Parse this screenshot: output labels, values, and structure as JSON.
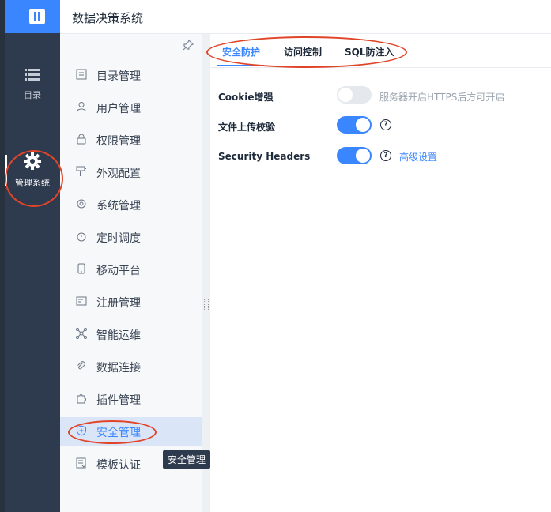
{
  "app": {
    "title": "数据决策系统"
  },
  "rail": {
    "items": [
      {
        "label": "目录",
        "icon": "list-icon"
      },
      {
        "label": "管理系统",
        "icon": "gear-icon"
      }
    ]
  },
  "menu": {
    "items": [
      {
        "label": "目录管理",
        "icon": "catalog-icon"
      },
      {
        "label": "用户管理",
        "icon": "user-icon"
      },
      {
        "label": "权限管理",
        "icon": "lock-icon"
      },
      {
        "label": "外观配置",
        "icon": "paint-icon"
      },
      {
        "label": "系统管理",
        "icon": "settings-icon"
      },
      {
        "label": "定时调度",
        "icon": "timer-icon"
      },
      {
        "label": "移动平台",
        "icon": "mobile-icon"
      },
      {
        "label": "注册管理",
        "icon": "register-icon"
      },
      {
        "label": "智能运维",
        "icon": "network-icon"
      },
      {
        "label": "数据连接",
        "icon": "link-icon"
      },
      {
        "label": "插件管理",
        "icon": "plugin-icon"
      },
      {
        "label": "安全管理",
        "icon": "shield-icon"
      },
      {
        "label": "模板认证",
        "icon": "template-icon"
      }
    ],
    "active_index": 11
  },
  "tooltip": {
    "text": "安全管理"
  },
  "tabs": [
    {
      "label": "安全防护"
    },
    {
      "label": "访问控制"
    },
    {
      "label": "SQL防注入"
    }
  ],
  "settings": [
    {
      "label": "Cookie增强",
      "enabled": false,
      "hint": "服务器开启HTTPS后方可开启"
    },
    {
      "label": "文件上传校验",
      "enabled": true,
      "help": "?"
    },
    {
      "label": "Security Headers",
      "enabled": true,
      "help": "?",
      "link": "高级设置"
    }
  ],
  "colors": {
    "accent": "#3a86ff",
    "rail": "#2e3a4d",
    "annotation": "#e0452a"
  }
}
